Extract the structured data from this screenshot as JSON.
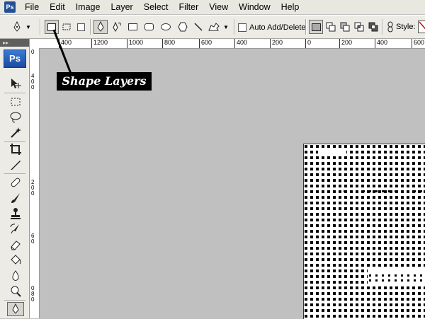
{
  "menu": {
    "app_icon": "ps-icon",
    "items": [
      "File",
      "Edit",
      "Image",
      "Layer",
      "Select",
      "Filter",
      "View",
      "Window",
      "Help"
    ]
  },
  "options_bar": {
    "auto_add_label": "Auto Add/Delete",
    "style_label": "Style:"
  },
  "toolbox": {
    "badge": "Ps",
    "grip": "▸▸"
  },
  "ruler_top": [
    "400",
    "1200",
    "1000",
    "800",
    "600",
    "400",
    "200",
    "0",
    "200",
    "400",
    "600"
  ],
  "ruler_left": [
    "0",
    "4",
    "0",
    "0",
    "2",
    "0",
    "0",
    "6",
    "0",
    "0",
    "8",
    "0"
  ],
  "callout": {
    "text": "Shape Layers"
  },
  "colors": {
    "workspace": "#c0c0c0",
    "callout_bg": "#000000",
    "ps_blue": "#244f95"
  }
}
